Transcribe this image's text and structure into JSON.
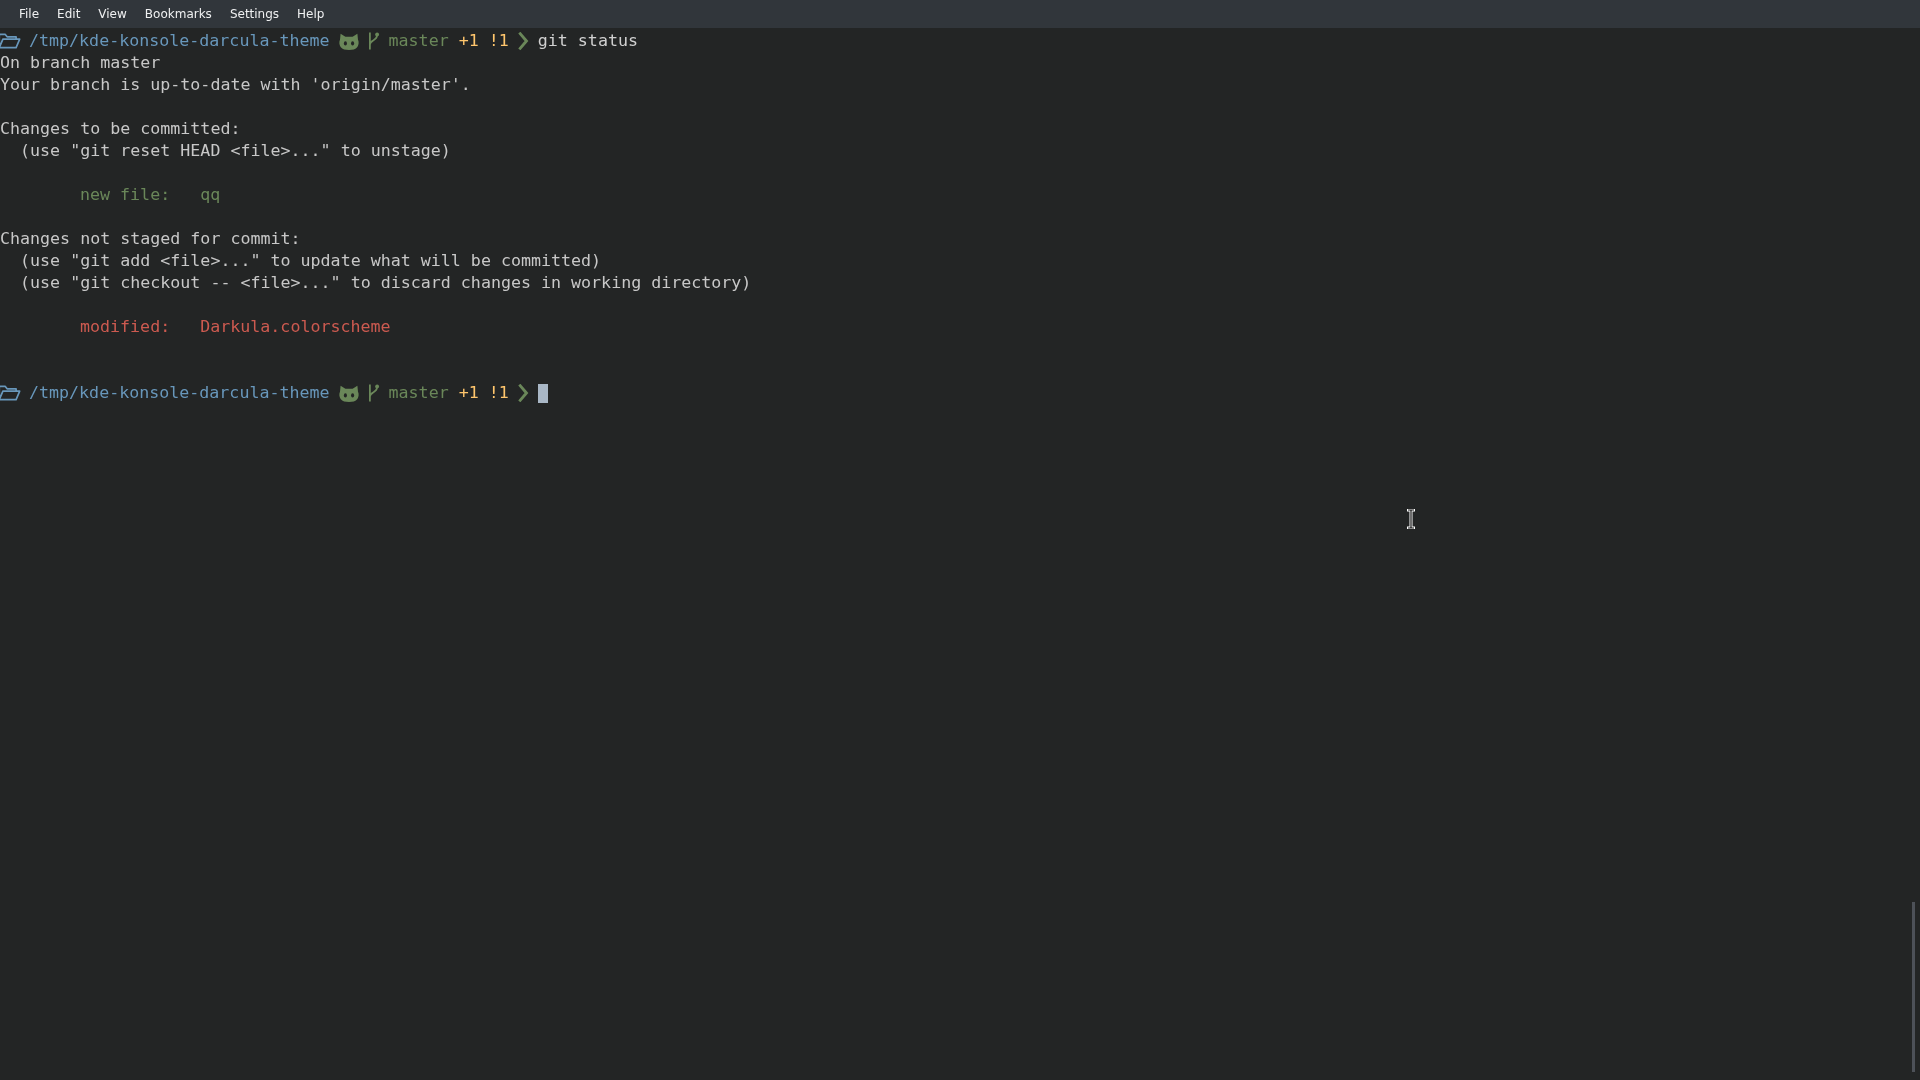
{
  "menu": [
    "File",
    "Edit",
    "View",
    "Bookmarks",
    "Settings",
    "Help"
  ],
  "lines": [
    {
      "kind": "prompt",
      "path": "/tmp/kde-konsole-darcula-theme",
      "branch": "master",
      "staged": "+1",
      "modified": "!1",
      "command": "git status",
      "cursor": false
    },
    {
      "kind": "text",
      "text": "On branch master"
    },
    {
      "kind": "text",
      "text": "Your branch is up-to-date with 'origin/master'."
    },
    {
      "kind": "blank"
    },
    {
      "kind": "text",
      "text": "Changes to be committed:"
    },
    {
      "kind": "text",
      "text": "  (use \"git reset HEAD <file>...\" to unstage)"
    },
    {
      "kind": "blank"
    },
    {
      "kind": "staged",
      "text": "new file:   qq"
    },
    {
      "kind": "blank"
    },
    {
      "kind": "text",
      "text": "Changes not staged for commit:"
    },
    {
      "kind": "text",
      "text": "  (use \"git add <file>...\" to update what will be committed)"
    },
    {
      "kind": "text",
      "text": "  (use \"git checkout -- <file>...\" to discard changes in working directory)"
    },
    {
      "kind": "blank"
    },
    {
      "kind": "modified",
      "text": "modified:   Darkula.colorscheme"
    },
    {
      "kind": "blank"
    },
    {
      "kind": "blank"
    },
    {
      "kind": "prompt",
      "path": "/tmp/kde-konsole-darcula-theme",
      "branch": "master",
      "staged": "+1",
      "modified": "!1",
      "cursor": true
    }
  ]
}
